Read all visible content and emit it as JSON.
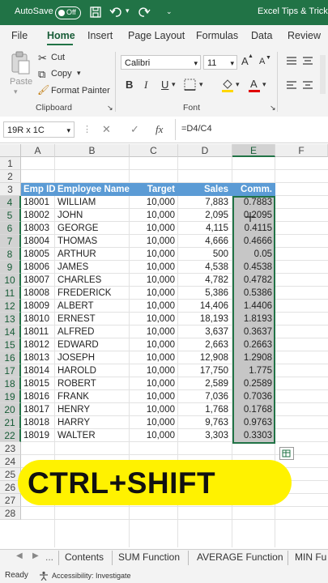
{
  "titlebar": {
    "autosave_label": "AutoSave",
    "autosave_state": "Off",
    "title": "Excel Tips & Tricks"
  },
  "tabs": [
    "File",
    "Home",
    "Insert",
    "Page Layout",
    "Formulas",
    "Data",
    "Review"
  ],
  "ribbon": {
    "clipboard": {
      "paste": "Paste",
      "cut": "Cut",
      "copy": "Copy",
      "format_painter": "Format Painter",
      "group_label": "Clipboard"
    },
    "font": {
      "family": "Calibri",
      "size": "11",
      "grow": "A",
      "shrink": "A",
      "bold": "B",
      "italic": "I",
      "underline": "U",
      "group_label": "Font"
    }
  },
  "formula_bar": {
    "name_box": "19R x 1C",
    "cancel": "✕",
    "enter": "✓",
    "fx": "fx",
    "formula": "=D4/C4"
  },
  "columns": [
    "A",
    "B",
    "C",
    "D",
    "E",
    "F"
  ],
  "rows": [
    "1",
    "2",
    "3",
    "4",
    "5",
    "6",
    "7",
    "8",
    "9",
    "10",
    "11",
    "12",
    "13",
    "14",
    "15",
    "16",
    "17",
    "18",
    "19",
    "20",
    "21",
    "22",
    "23",
    "24",
    "25",
    "26",
    "27",
    "28"
  ],
  "table": {
    "headers": [
      "Emp ID",
      "Employee Name",
      "Target",
      "Sales",
      "Comm."
    ],
    "rows": [
      [
        "18001",
        "WILLIAM",
        "10,000",
        "7,883",
        "0.7883"
      ],
      [
        "18002",
        "JOHN",
        "10,000",
        "2,095",
        "0.2095"
      ],
      [
        "18003",
        "GEORGE",
        "10,000",
        "4,115",
        "0.4115"
      ],
      [
        "18004",
        "THOMAS",
        "10,000",
        "4,666",
        "0.4666"
      ],
      [
        "18005",
        "ARTHUR",
        "10,000",
        "500",
        "0.05"
      ],
      [
        "18006",
        "JAMES",
        "10,000",
        "4,538",
        "0.4538"
      ],
      [
        "18007",
        "CHARLES",
        "10,000",
        "4,782",
        "0.4782"
      ],
      [
        "18008",
        "FREDERICK",
        "10,000",
        "5,386",
        "0.5386"
      ],
      [
        "18009",
        "ALBERT",
        "10,000",
        "14,406",
        "1.4406"
      ],
      [
        "18010",
        "ERNEST",
        "10,000",
        "18,193",
        "1.8193"
      ],
      [
        "18011",
        "ALFRED",
        "10,000",
        "3,637",
        "0.3637"
      ],
      [
        "18012",
        "EDWARD",
        "10,000",
        "2,663",
        "0.2663"
      ],
      [
        "18013",
        "JOSEPH",
        "10,000",
        "12,908",
        "1.2908"
      ],
      [
        "18014",
        "HAROLD",
        "10,000",
        "17,750",
        "1.775"
      ],
      [
        "18015",
        "ROBERT",
        "10,000",
        "2,589",
        "0.2589"
      ],
      [
        "18016",
        "FRANK",
        "10,000",
        "7,036",
        "0.7036"
      ],
      [
        "18017",
        "HENRY",
        "10,000",
        "1,768",
        "0.1768"
      ],
      [
        "18018",
        "HARRY",
        "10,000",
        "9,763",
        "0.9763"
      ],
      [
        "18019",
        "WALTER",
        "10,000",
        "3,303",
        "0.3303"
      ]
    ]
  },
  "banner": {
    "text": "CTRL+SHIFT"
  },
  "sheet_tabs": {
    "ellipsis": "...",
    "tabs": [
      "Contents",
      "SUM Function",
      "AVERAGE Function",
      "MIN Fu"
    ]
  },
  "status": {
    "ready": "Ready",
    "accessibility": "Accessibility: Investigate"
  },
  "colors": {
    "excel_green": "#217346",
    "header_blue": "#5b9bd5",
    "selection_gray": "#c6c6c6",
    "banner_yellow": "#fff200"
  }
}
